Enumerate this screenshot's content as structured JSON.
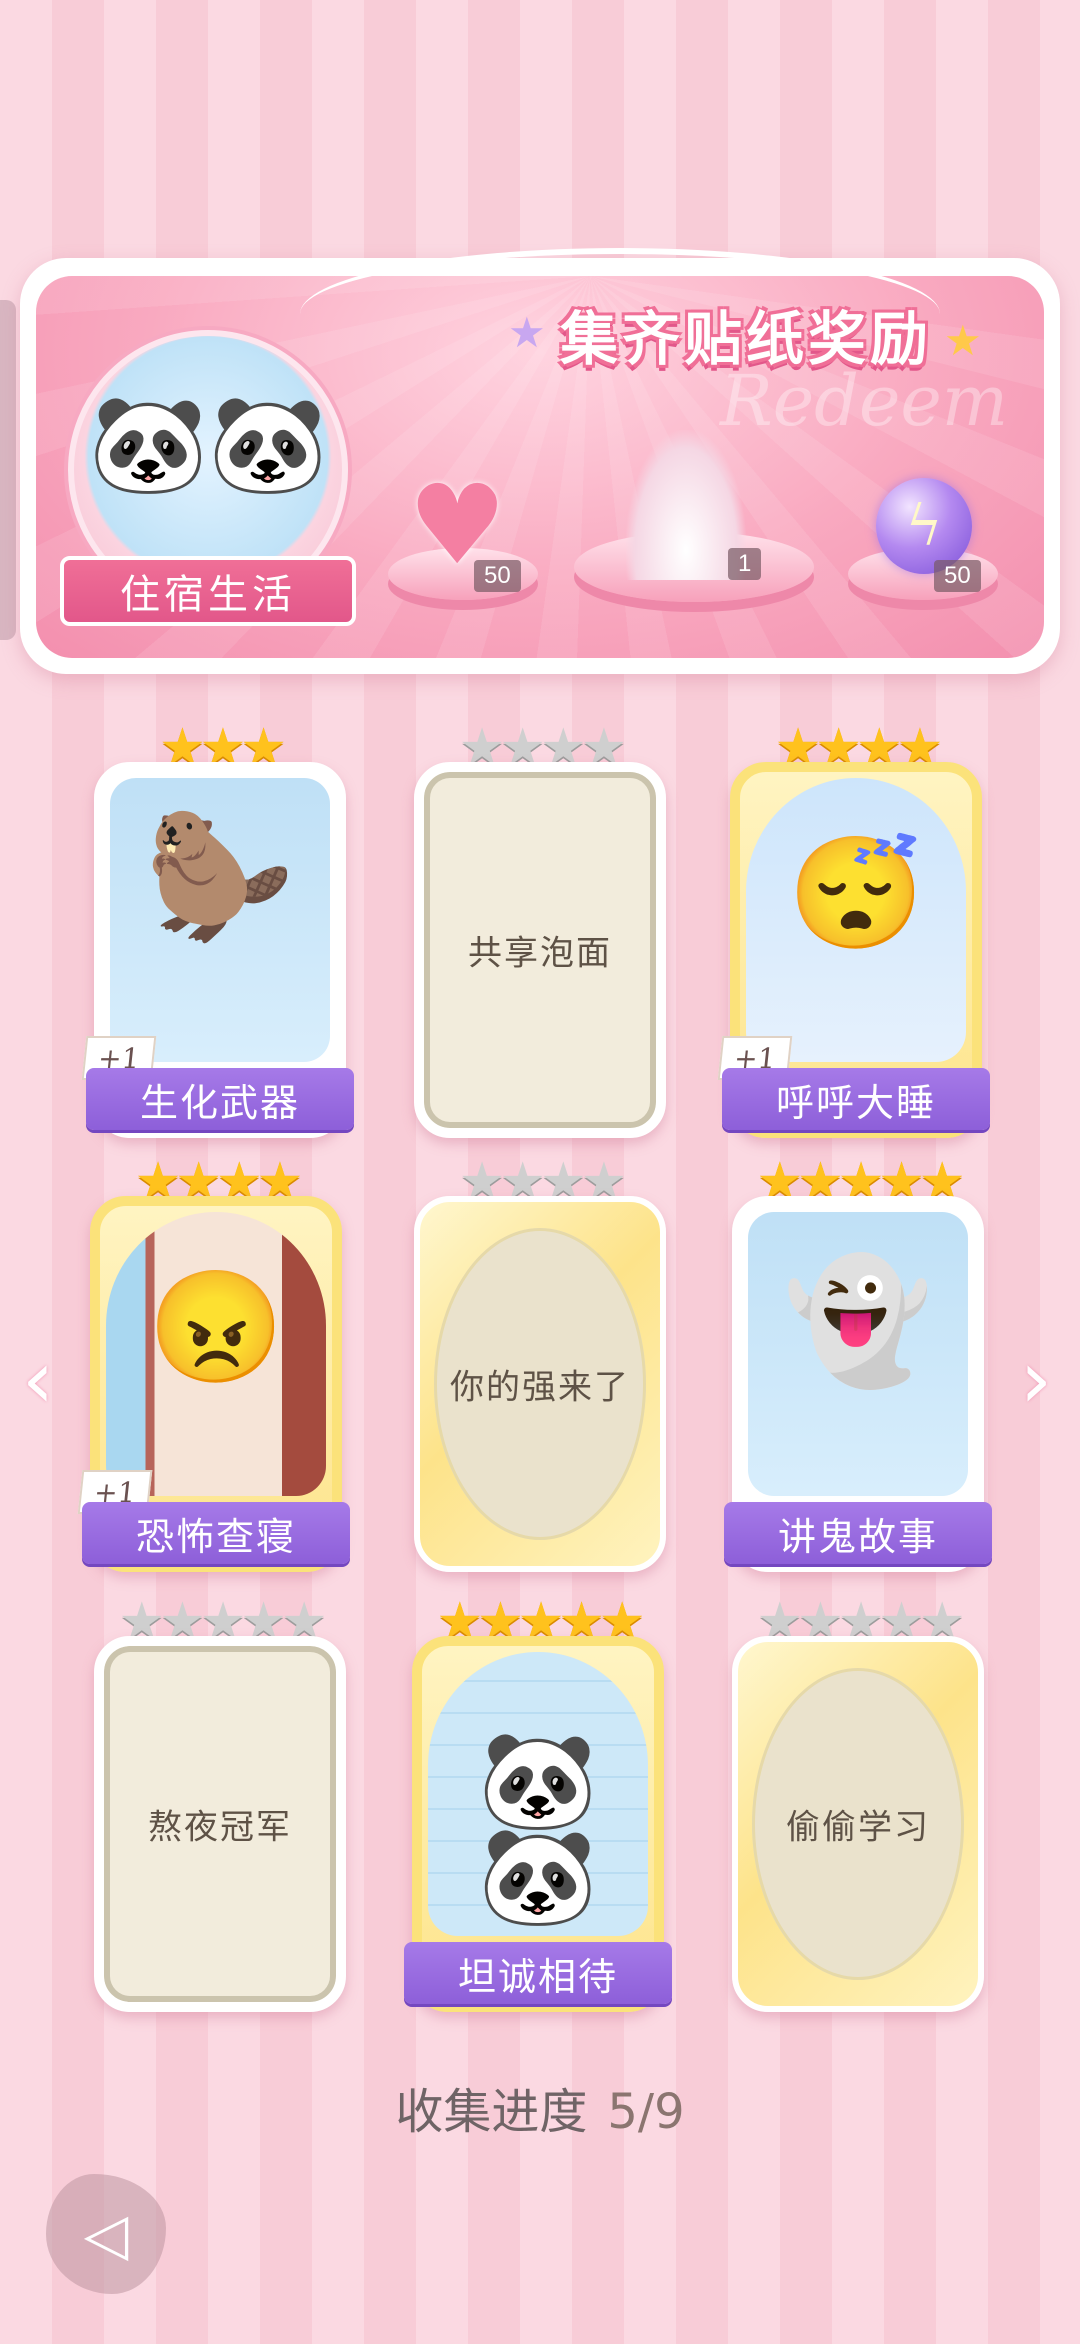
{
  "banner": {
    "title": "集齐贴纸奖励",
    "watermark": "Redeem",
    "set_name": "住宿生活",
    "rewards": [
      {
        "icon": "pink-heart-gem-icon",
        "count": "50"
      },
      {
        "icon": "dress-outfit-icon",
        "count": "1"
      },
      {
        "icon": "energy-orb-icon",
        "count": "50"
      }
    ]
  },
  "stickers": [
    {
      "name": "生化武器",
      "stars": 3,
      "collected": true,
      "extra": "+1"
    },
    {
      "name": "共享泡面",
      "stars": 4,
      "collected": false
    },
    {
      "name": "呼呼大睡",
      "stars": 4,
      "collected": true,
      "extra": "+1"
    },
    {
      "name": "恐怖查寝",
      "stars": 4,
      "collected": true,
      "extra": "+1"
    },
    {
      "name": "你的强来了",
      "stars": 4,
      "collected": false
    },
    {
      "name": "讲鬼故事",
      "stars": 5,
      "collected": true
    },
    {
      "name": "熬夜冠军",
      "stars": 5,
      "collected": false
    },
    {
      "name": "坦诚相待",
      "stars": 5,
      "collected": true
    },
    {
      "name": "偷偷学习",
      "stars": 5,
      "collected": false
    }
  ],
  "progress": {
    "label": "收集进度",
    "value": "5/9"
  },
  "colors": {
    "accent": "#f06f97",
    "label_purple": "#9a6ce0",
    "star_gold": "#ffc21d"
  }
}
